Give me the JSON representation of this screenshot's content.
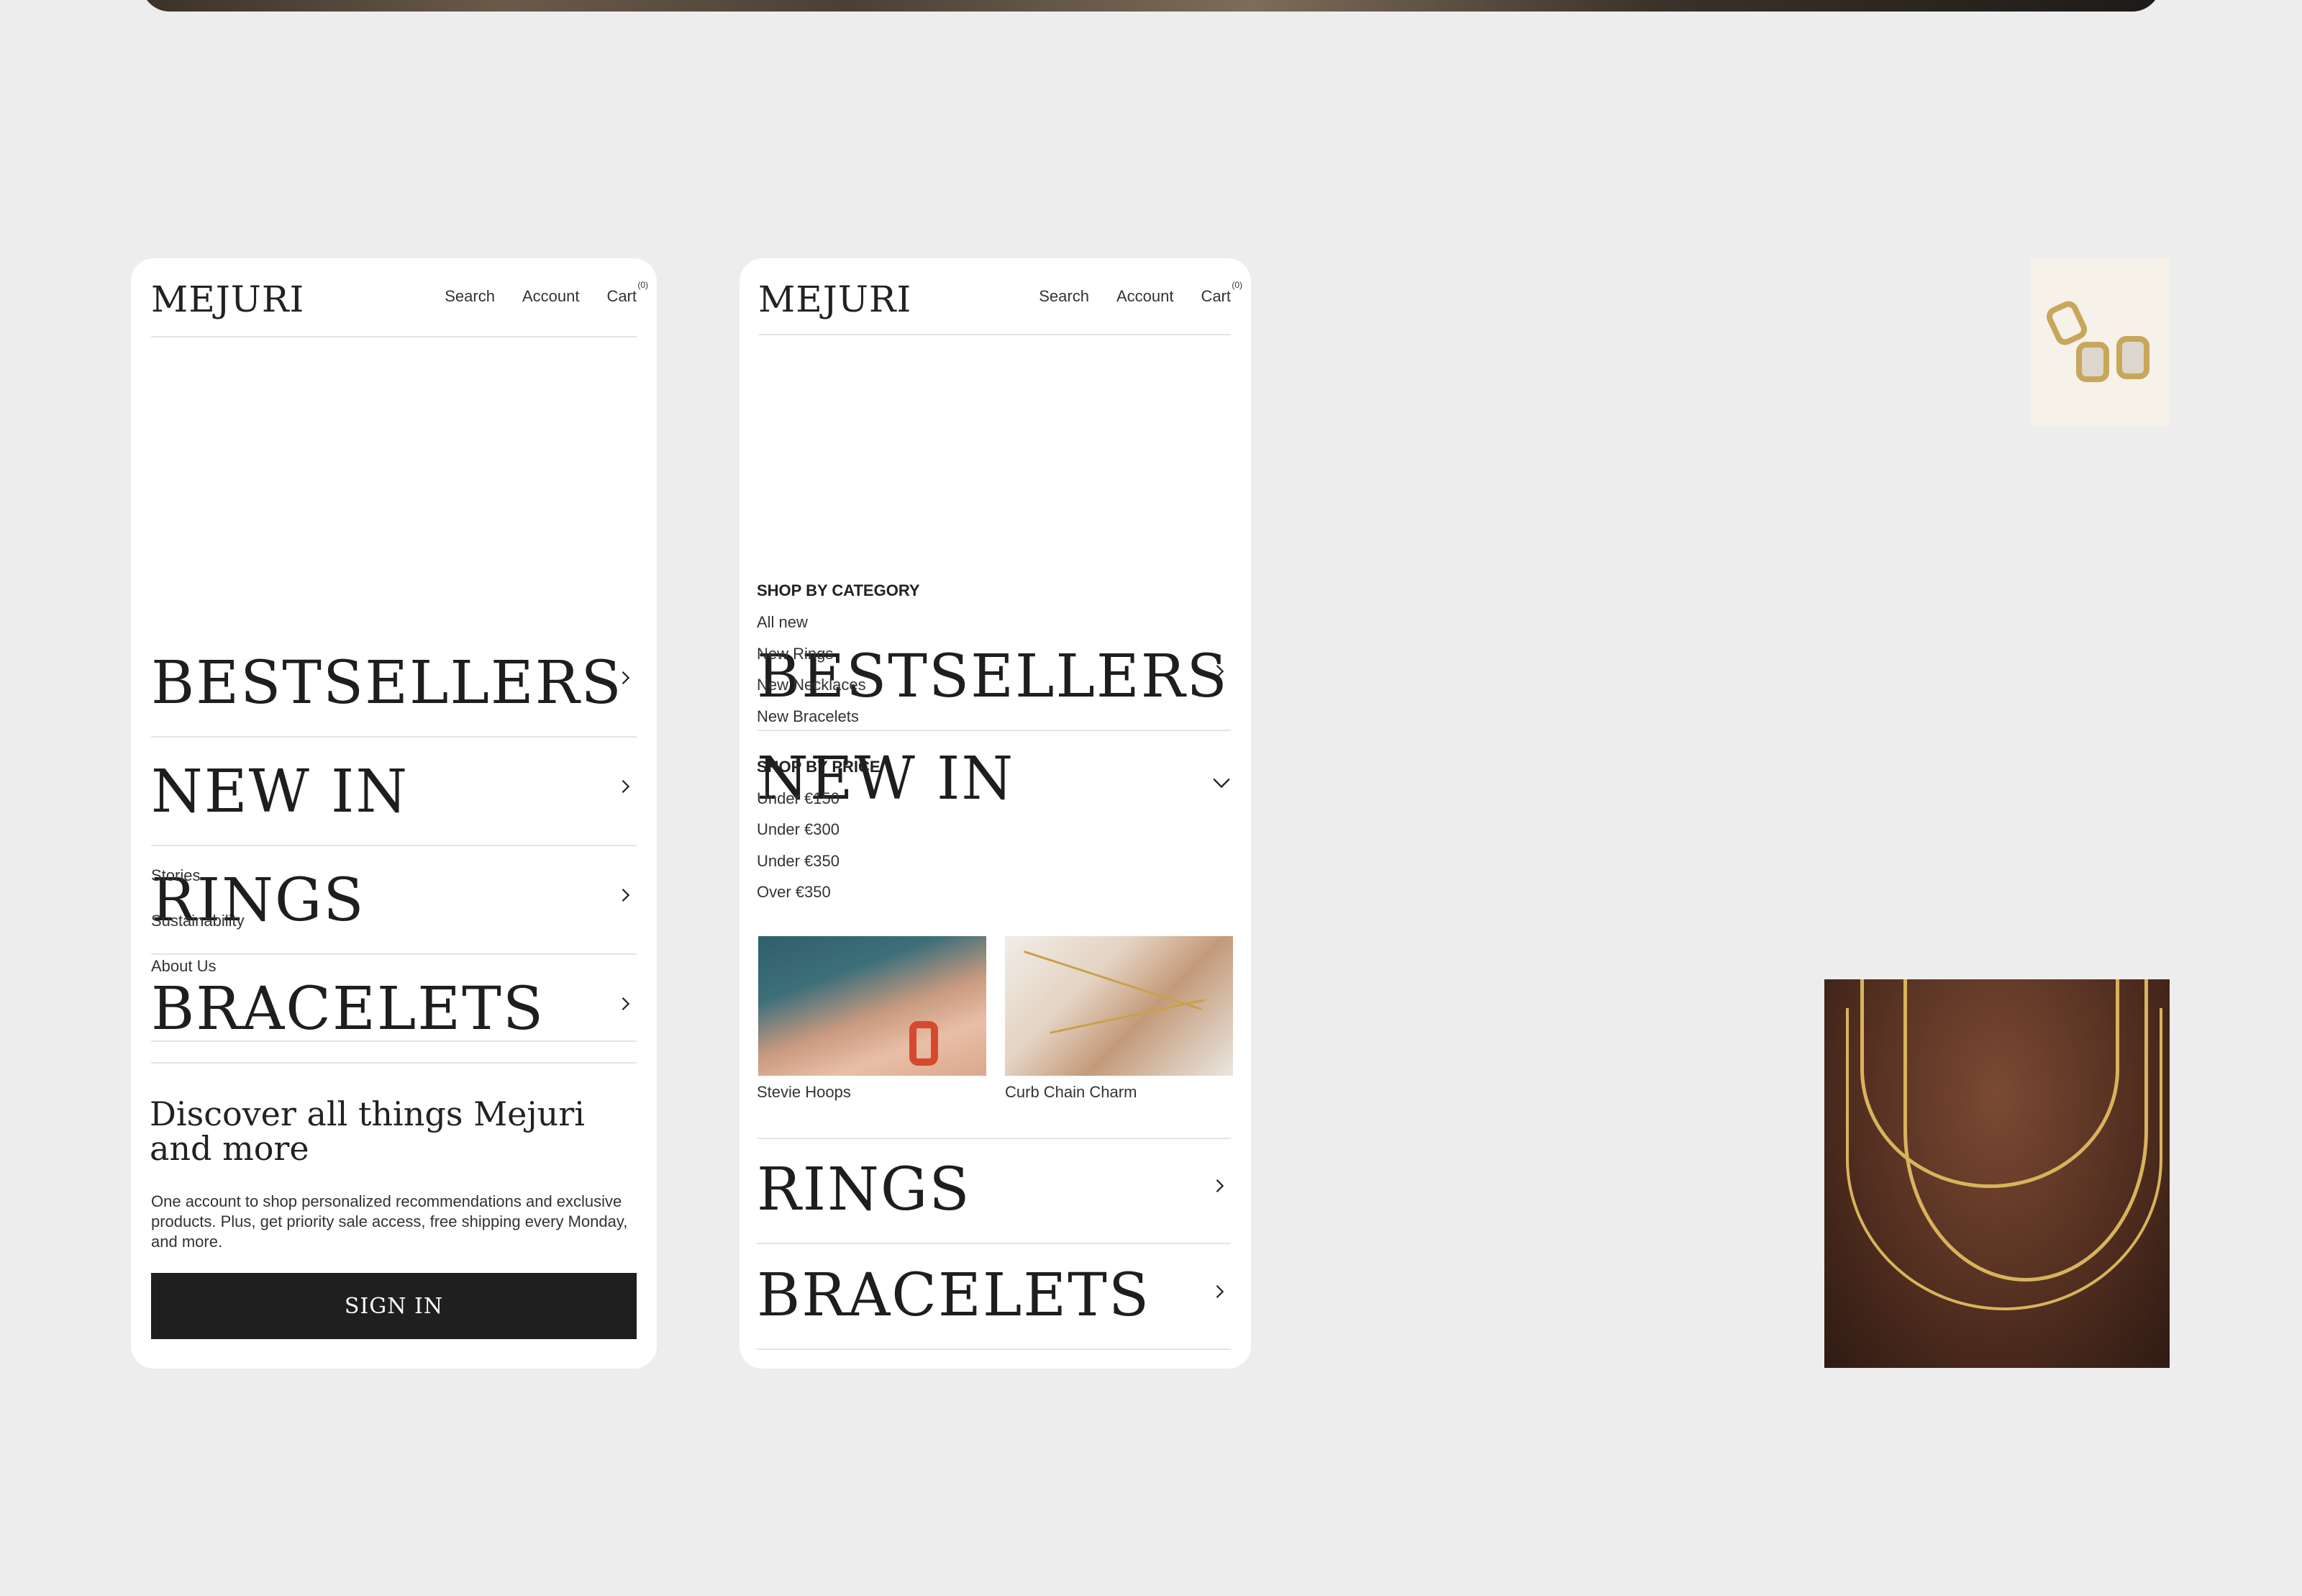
{
  "brand": "MEJURI",
  "header": {
    "search": "Search",
    "account": "Account",
    "cart": "Cart",
    "cart_count": "(0)"
  },
  "screen1": {
    "menu": [
      "BESTSELLERS",
      "NEW IN",
      "RINGS",
      "BRACELETS"
    ],
    "links": [
      "Stories",
      "Sustainability",
      "About Us"
    ],
    "discover_title": "Discover all things Mejuri and more",
    "discover_text": "One account to shop personalized recommendations and exclusive products. Plus, get priority sale access, free shipping every Monday, and more.",
    "signin": "SIGN IN"
  },
  "screen2": {
    "menu_top": [
      "BESTSELLERS",
      "NEW IN"
    ],
    "category_heading": "SHOP BY CATEGORY",
    "categories": [
      "All new",
      "New Rings",
      "New Necklaces",
      "New Bracelets"
    ],
    "price_heading": "SHOP BY PRICE",
    "prices": [
      "Under €150",
      "Under €300",
      "Under €350",
      "Over €350"
    ],
    "products": [
      "Stevie Hoops",
      "Curb Chain Charm"
    ],
    "menu_bottom": [
      "RINGS",
      "BRACELETS"
    ]
  },
  "colors": {
    "background": "#ededed",
    "panel": "#ffffff",
    "button": "#1f1f1f",
    "gold": "#c8a65a"
  }
}
